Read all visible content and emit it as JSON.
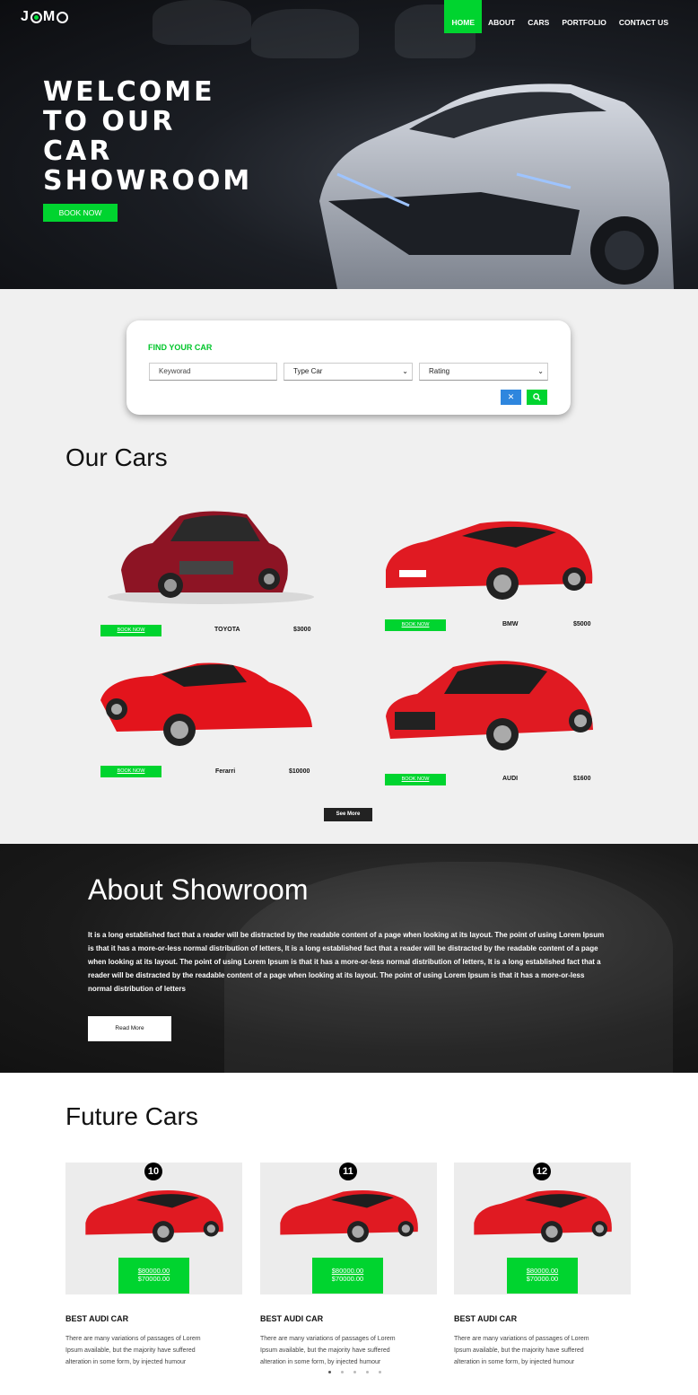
{
  "brand": {
    "logo": "JOMO"
  },
  "nav": [
    "HOME",
    "ABOUT",
    "CARS",
    "PORTFOLIO",
    "CONTACT US"
  ],
  "hero": {
    "title_lines": [
      "WELCOME",
      "TO OUR",
      "CAR",
      "SHOWROOM"
    ],
    "cta": "BOOK NOW"
  },
  "search": {
    "title": "FIND YOUR CAR",
    "keyword_placeholder": "Keyworad",
    "type_select": "Type Car",
    "rating_select": "Rating",
    "clear_icon": "close-icon",
    "search_icon": "search-icon"
  },
  "our_cars": {
    "heading": "Our Cars",
    "items": [
      {
        "book": "BOOK NOW",
        "name": "TOYOTA",
        "price": "$3000"
      },
      {
        "book": "BOOK NOW",
        "name": "BMW",
        "price": "$5000"
      },
      {
        "book": "BOOK NOW",
        "name": "Ferarri",
        "price": "$10000"
      },
      {
        "book": "BOOK NOW",
        "name": "AUDI",
        "price": "$1600"
      }
    ],
    "see_more": "See More"
  },
  "about": {
    "heading": "About Showroom",
    "text": "It is a long established fact that a reader will be distracted by the readable content of a page when looking at its layout. The point of using Lorem Ipsum is that it has a more-or-less normal distribution of letters, It is a long established fact that a reader will be distracted by the readable content of a page when looking at its layout. The point of using Lorem Ipsum is that it has a more-or-less normal distribution of letters, It is a long established fact that a reader will be distracted by the readable content of a page when looking at its layout. The point of using Lorem Ipsum is that it has a more-or-less normal distribution of letters",
    "cta": "Read More"
  },
  "future": {
    "heading": "Future Cars",
    "items": [
      {
        "num": "10",
        "old_price": "$80000.00",
        "price": "$70000.00",
        "title": "BEST AUDI CAR",
        "desc": "There are many variations of passages of Lorem Ipsum available, but the majority have suffered alteration in some form, by injected humour"
      },
      {
        "num": "11",
        "old_price": "$80000.00",
        "price": "$70000.00",
        "title": "BEST AUDI CAR",
        "desc": "There are many variations of passages of Lorem Ipsum available, but the majority have suffered alteration in some form, by injected humour"
      },
      {
        "num": "12",
        "old_price": "$80000.00",
        "price": "$70000.00",
        "title": "BEST AUDI CAR",
        "desc": "There are many variations of passages of Lorem Ipsum available, but the majority have suffered alteration in some form, by injected humour"
      }
    ]
  },
  "colors": {
    "accent": "#00d42f",
    "blue": "#2e86de",
    "dark": "#1a1a1a"
  }
}
